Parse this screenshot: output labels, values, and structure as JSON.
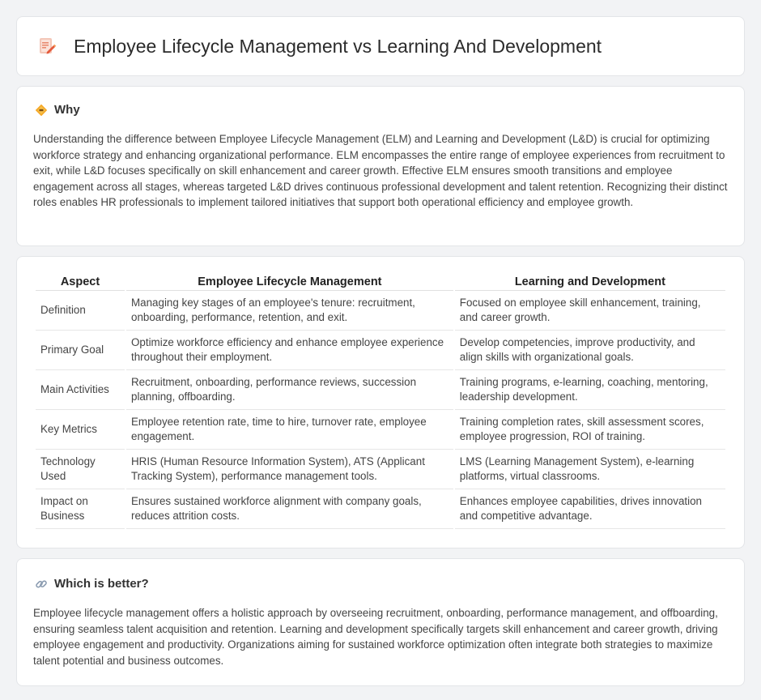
{
  "page": {
    "title": "Employee Lifecycle Management vs Learning And Development"
  },
  "why": {
    "heading": "Why",
    "icon": "diamond-sign-icon",
    "body": "Understanding the difference between Employee Lifecycle Management (ELM) and Learning and Development (L&D) is crucial for optimizing workforce strategy and enhancing organizational performance. ELM encompasses the entire range of employee experiences from recruitment to exit, while L&D focuses specifically on skill enhancement and career growth. Effective ELM ensures smooth transitions and employee engagement across all stages, whereas targeted L&D drives continuous professional development and talent retention. Recognizing their distinct roles enables HR professionals to implement tailored initiatives that support both operational efficiency and employee growth."
  },
  "table": {
    "headers": [
      "Aspect",
      "Employee Lifecycle Management",
      "Learning and Development"
    ],
    "rows": [
      [
        "Definition",
        "Managing key stages of an employee's tenure: recruitment, onboarding, performance, retention, and exit.",
        "Focused on employee skill enhancement, training, and career growth."
      ],
      [
        "Primary Goal",
        "Optimize workforce efficiency and enhance employee experience throughout their employment.",
        "Develop competencies, improve productivity, and align skills with organizational goals."
      ],
      [
        "Main Activities",
        "Recruitment, onboarding, performance reviews, succession planning, offboarding.",
        "Training programs, e-learning, coaching, mentoring, leadership development."
      ],
      [
        "Key Metrics",
        "Employee retention rate, time to hire, turnover rate, employee engagement.",
        "Training completion rates, skill assessment scores, employee progression, ROI of training."
      ],
      [
        "Technology Used",
        "HRIS (Human Resource Information System), ATS (Applicant Tracking System), performance management tools.",
        "LMS (Learning Management System), e-learning platforms, virtual classrooms."
      ],
      [
        "Impact on Business",
        "Ensures sustained workforce alignment with company goals, reduces attrition costs.",
        "Enhances employee capabilities, drives innovation and competitive advantage."
      ]
    ]
  },
  "better": {
    "heading": "Which is better?",
    "icon": "link-icon",
    "body": "Employee lifecycle management offers a holistic approach by overseeing recruitment, onboarding, performance management, and offboarding, ensuring seamless talent acquisition and retention. Learning and development specifically targets skill enhancement and career growth, driving employee engagement and productivity. Organizations aiming for sustained workforce optimization often integrate both strategies to maximize talent potential and business outcomes."
  }
}
